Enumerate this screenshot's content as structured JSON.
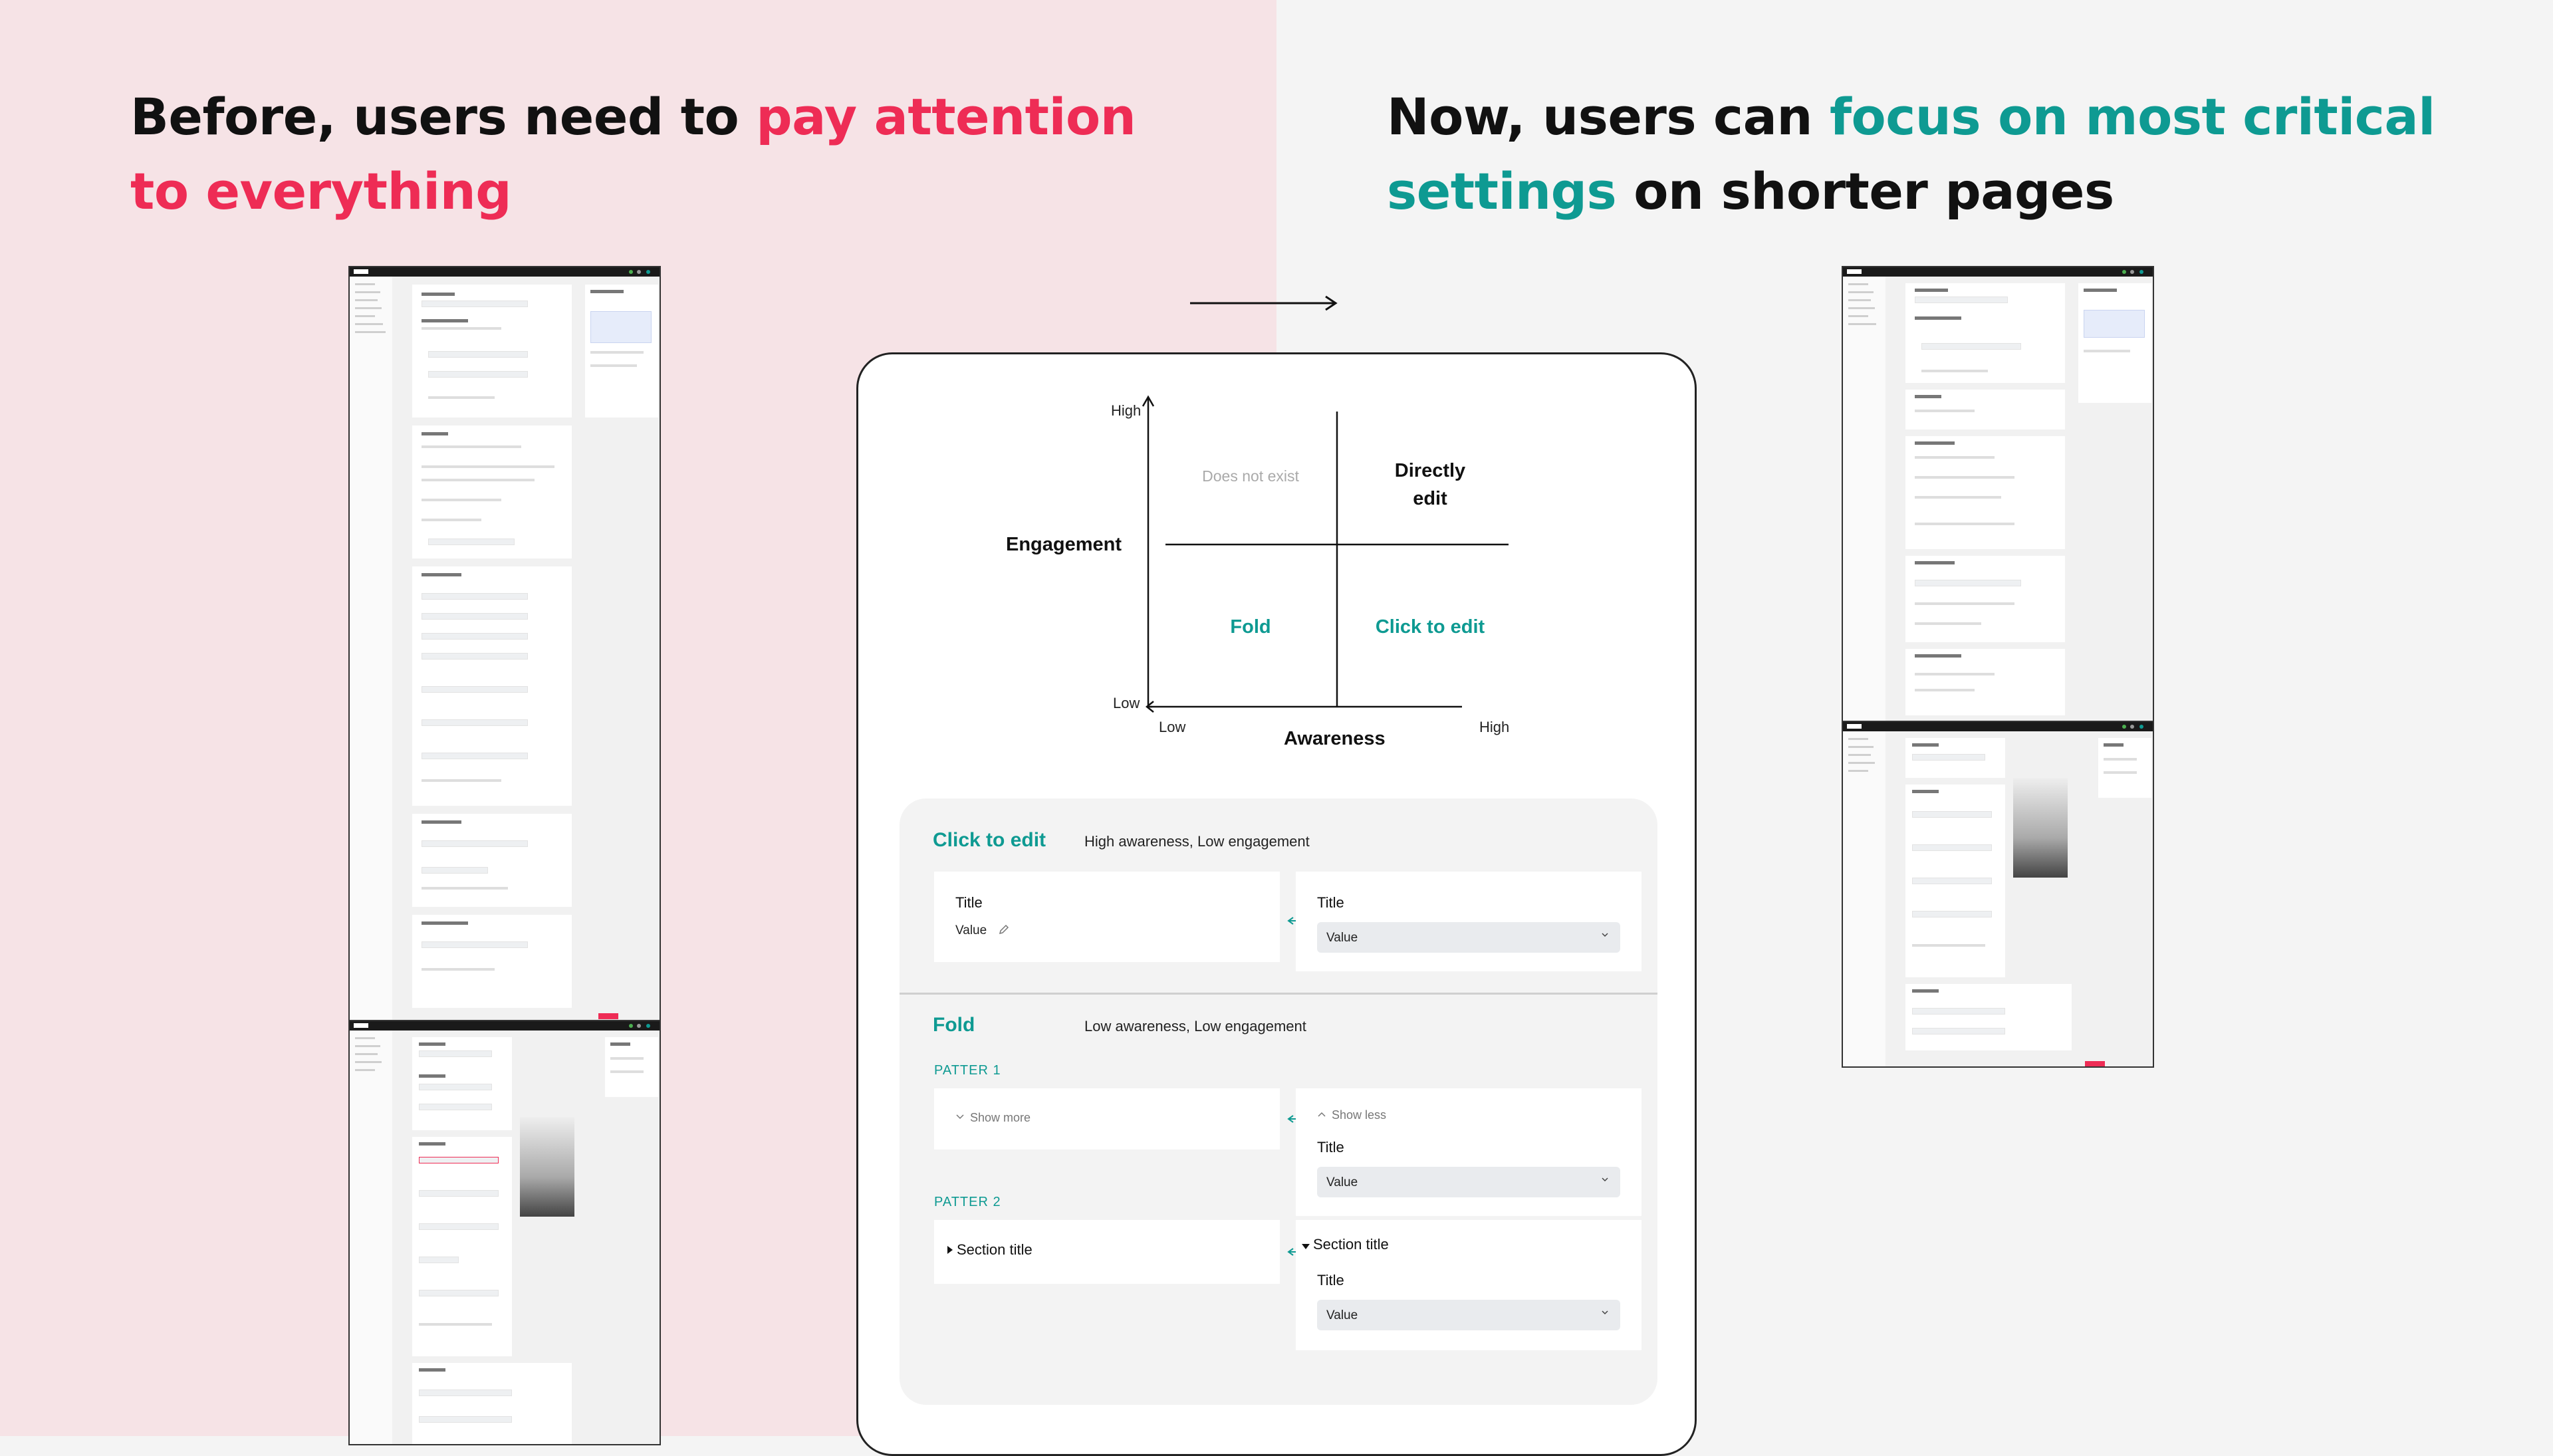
{
  "left_heading": {
    "prefix": "Before, users need to ",
    "highlight": "pay attention to everything"
  },
  "right_heading": {
    "prefix": "Now, users can ",
    "highlight": "focus on most critical settings",
    "suffix": " on shorter pages"
  },
  "colors": {
    "pink_accent": "#ee2c55",
    "teal_accent": "#0e9a92",
    "left_background": "#f6e3e6",
    "right_background": "#f4f4f4"
  },
  "screenshots": {
    "brand": "TikTok",
    "left_top_alt": "Campaign setup page (long)",
    "left_bottom_alt": "Ad creation page (long)",
    "right_top_alt": "Campaign setup page (shorter)",
    "right_bottom_alt": "Ad creation page (shorter)"
  },
  "matrix": {
    "y_high": "High",
    "y_low": "Low",
    "x_low": "Low",
    "x_high": "High",
    "y_title": "Engagement",
    "x_title": "Awareness",
    "q_top_left": "Does not exist",
    "q_top_right_line1": "Directly",
    "q_top_right_line2": "edit",
    "q_bottom_left": "Fold",
    "q_bottom_right": "Click to edit"
  },
  "click_to_edit": {
    "title": "Click to edit",
    "desc": "High awareness, Low engagement",
    "before_title": "Title",
    "before_value": "Value",
    "after_title": "Title",
    "after_value": "Value"
  },
  "fold": {
    "title": "Fold",
    "desc": "Low awareness, Low engagement",
    "pattern1": "PATTER 1",
    "show_more": "Show more",
    "show_less": "Show less",
    "p1_title": "Title",
    "p1_value": "Value",
    "pattern2": "PATTER 2",
    "section_title_collapsed": "Section title",
    "section_title_expanded": "Section title",
    "p2_title": "Title",
    "p2_value": "Value"
  }
}
